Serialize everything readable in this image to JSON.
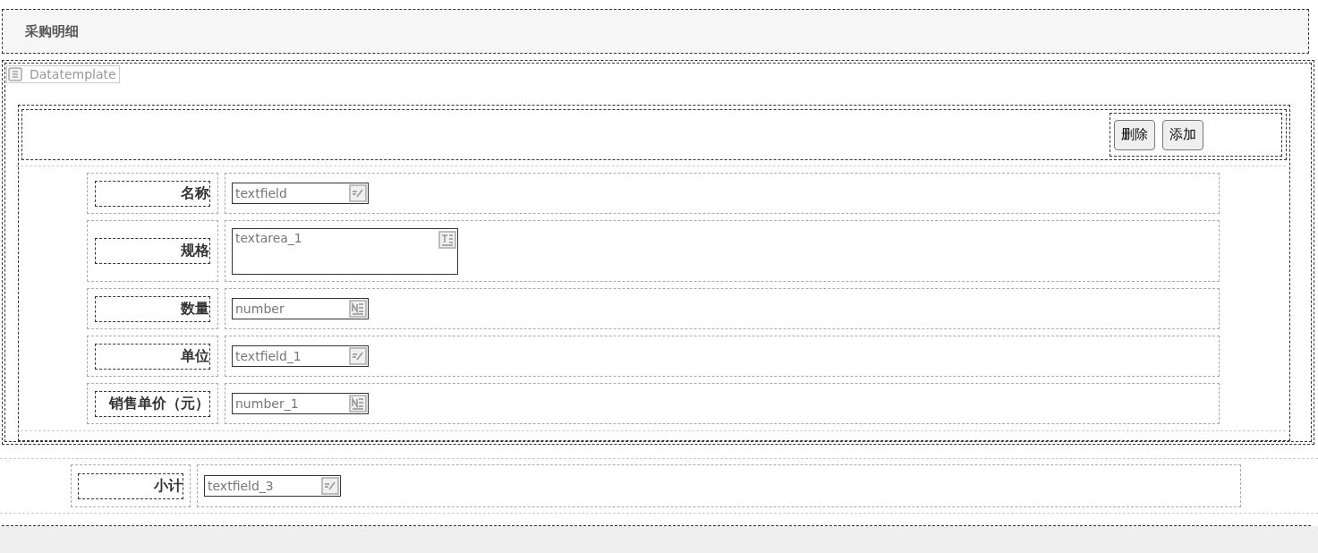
{
  "section_title": "采购明细",
  "template": {
    "label": "Datatemplate",
    "buttons": [
      "删除",
      "添加"
    ],
    "rows": [
      {
        "label": "名称",
        "field": {
          "kind": "textfield",
          "value": "textfield"
        }
      },
      {
        "label": "规格",
        "field": {
          "kind": "textarea",
          "value": "textarea_1"
        }
      },
      {
        "label": "数量",
        "field": {
          "kind": "number",
          "value": "number"
        }
      },
      {
        "label": "单位",
        "field": {
          "kind": "textfield",
          "value": "textfield_1"
        }
      },
      {
        "label": "销售单价（元）",
        "field": {
          "kind": "number",
          "value": "number_1"
        }
      }
    ]
  },
  "summary": {
    "rows": [
      {
        "label": "小计",
        "field": {
          "kind": "textfield",
          "value": "textfield_3"
        }
      }
    ]
  }
}
